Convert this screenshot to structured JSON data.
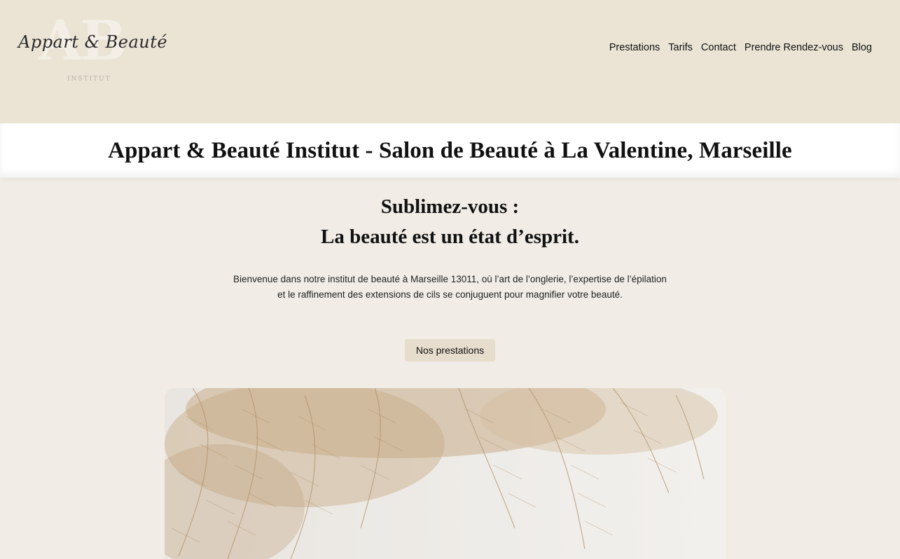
{
  "header": {
    "logo": {
      "monogram": "AB",
      "script_text": "Appart & Beauté",
      "subtitle": "INSTITUT"
    },
    "nav": [
      "Prestations",
      "Tarifs",
      "Contact",
      "Prendre Rendez-vous",
      "Blog"
    ]
  },
  "title_band": {
    "title": "Appart & Beauté Institut - Salon de Beauté à La Valentine, Marseille"
  },
  "hero": {
    "heading_line1": "Sublimez-vous :",
    "heading_line2": "La beauté est un état d’esprit.",
    "intro_line1": "Bienvenue dans notre institut de beauté à Marseille 13011, où l’art de l’onglerie, l’expertise de l’épilation",
    "intro_line2": "et le raffinement des extensions de cils se conjuguent pour magnifier votre beauté.",
    "cta_label": "Nos prestations"
  },
  "colors": {
    "header_bg": "#ebe4d5",
    "page_bg": "#f1ece6",
    "button_bg": "#e6ddcd"
  }
}
